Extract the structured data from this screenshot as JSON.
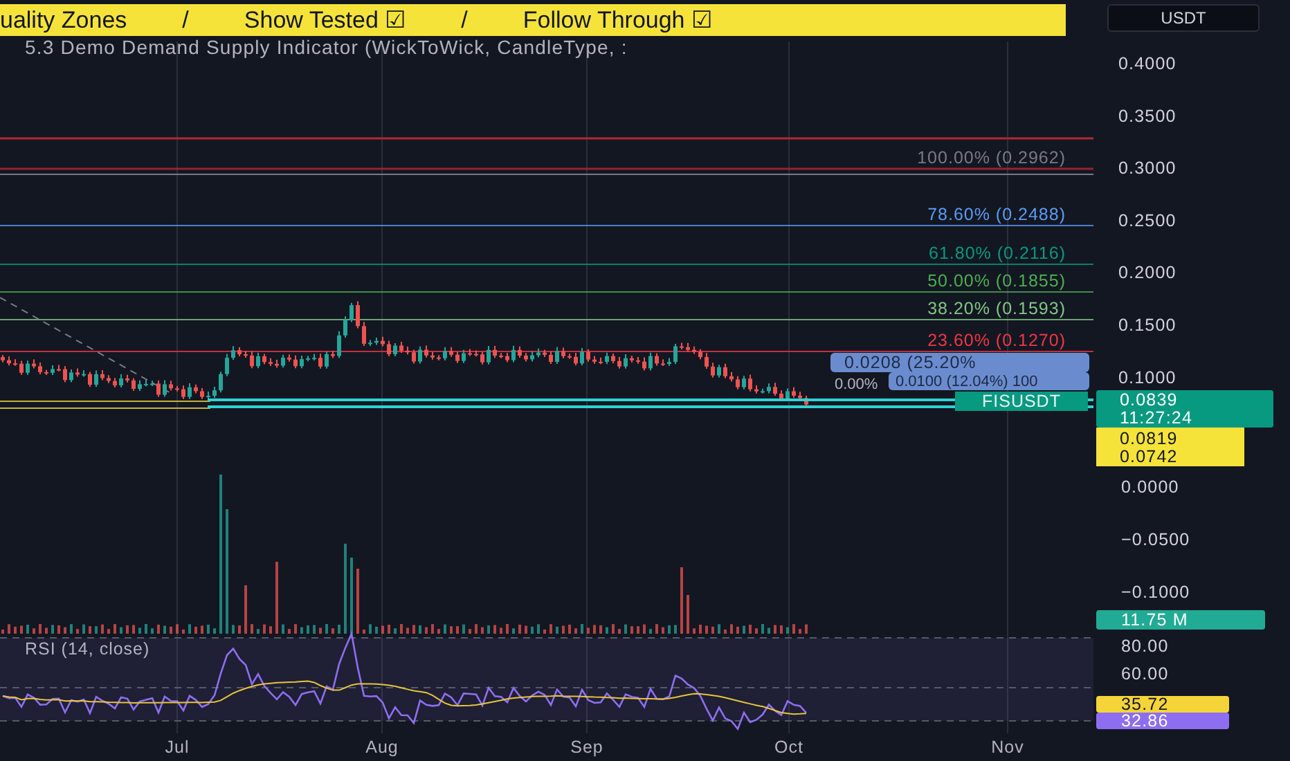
{
  "header": {
    "banner_items": [
      "uality Zones",
      "/",
      "Show Tested ☑",
      "/",
      "Follow Through ☑"
    ],
    "indicator_title": "5.3 Demo Demand Supply Indicator (WickToWick, CandleType, :"
  },
  "currency_button": "USDT",
  "price_axis": [
    "0.4000",
    "0.3500",
    "0.3000",
    "0.2500",
    "0.2000",
    "0.1500",
    "0.1000"
  ],
  "fib_levels": [
    {
      "label": "100.00% (0.2962)",
      "color": "#787b86"
    },
    {
      "label": "78.60% (0.2488)",
      "color": "#5b9cf6"
    },
    {
      "label": "61.80% (0.2116)",
      "color": "#089981"
    },
    {
      "label": "50.00% (0.1855)",
      "color": "#4caf50"
    },
    {
      "label": "38.20% (0.1593)",
      "color": "#81c784"
    },
    {
      "label": "23.60% (0.1270)",
      "color": "#f23645"
    }
  ],
  "measurements": [
    "0.0208 (25.20%",
    "0.0100 (12.04%) 100"
  ],
  "zero_label": "0.00%",
  "symbol_tag": "FISUSDT",
  "last_price": {
    "price": "0.0839",
    "countdown": "11:27:24"
  },
  "zone_prices": [
    "0.0819",
    "0.0742"
  ],
  "volume_axis": [
    "0.0000",
    "−0.0500",
    "−0.1000"
  ],
  "volume_tag": "11.75 M",
  "rsi": {
    "title": "RSI (14, close)",
    "axis_labels": [
      "80.00",
      "60.00"
    ],
    "ma_value": "35.72",
    "rsi_value": "32.86"
  },
  "time_axis": [
    "Jul",
    "Aug",
    "Sep",
    "Oct",
    "Nov"
  ]
}
